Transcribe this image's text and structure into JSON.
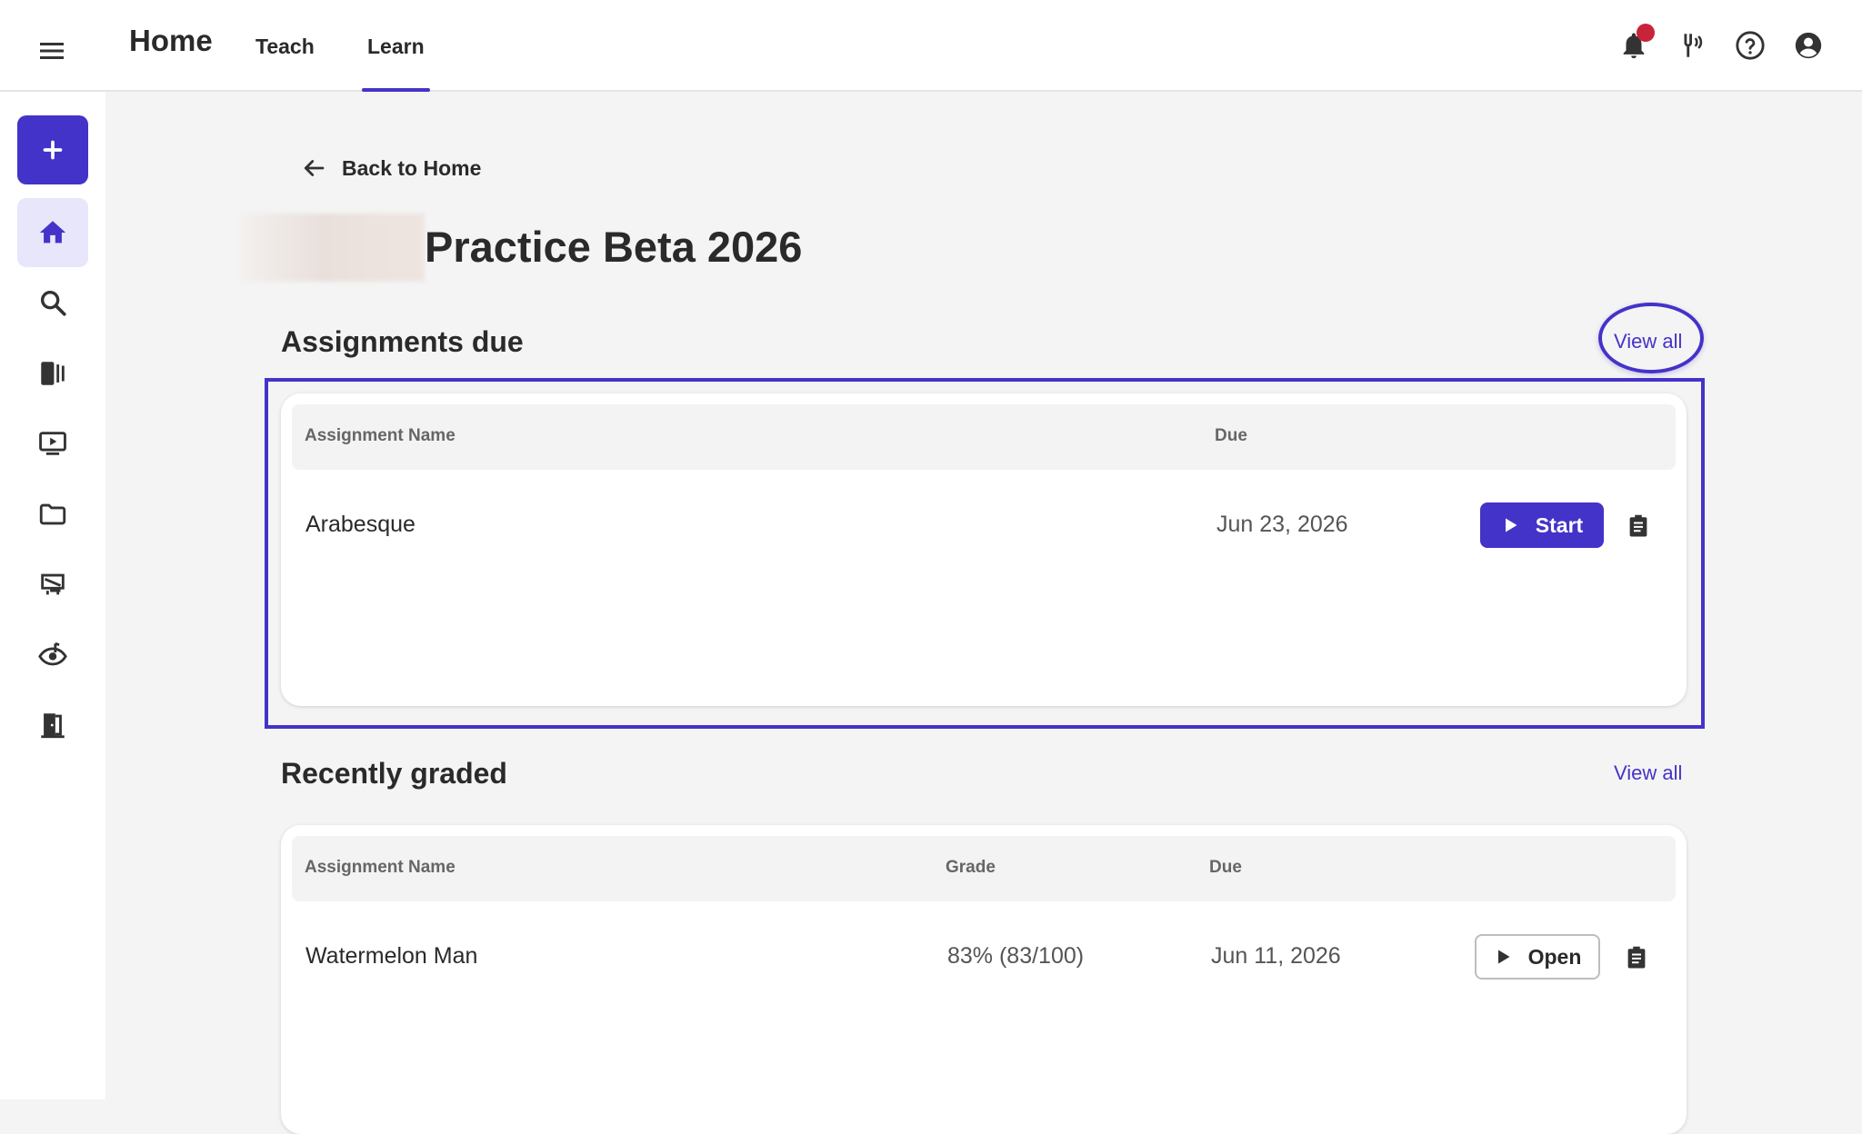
{
  "header": {
    "brand": "Home",
    "tabs": [
      {
        "label": "Teach",
        "active": false
      },
      {
        "label": "Learn",
        "active": true
      }
    ],
    "icons": [
      "bell-icon",
      "tuning-fork-icon",
      "help-icon",
      "account-icon"
    ],
    "notification_badge_color": "#c7243a"
  },
  "sidebar": {
    "items": [
      "add-icon",
      "home-icon",
      "search-icon",
      "library-icon",
      "video-icon",
      "folder-icon",
      "score-icon",
      "ear-training-icon",
      "exit-icon"
    ],
    "accent": "#4433c8"
  },
  "back_link": {
    "label": "Back to Home"
  },
  "course": {
    "title": "Practice Beta 2026"
  },
  "assignments_due": {
    "title": "Assignments due",
    "view_all": "View all",
    "columns": {
      "name": "Assignment Name",
      "due": "Due"
    },
    "rows": [
      {
        "name": "Arabesque",
        "due": "Jun 23, 2026",
        "action": "Start"
      }
    ]
  },
  "recently_graded": {
    "title": "Recently graded",
    "view_all": "View all",
    "columns": {
      "name": "Assignment Name",
      "grade": "Grade",
      "due": "Due"
    },
    "rows": [
      {
        "name": "Watermelon Man",
        "grade": "83% (83/100)",
        "due": "Jun 11, 2026",
        "action": "Open"
      }
    ]
  }
}
